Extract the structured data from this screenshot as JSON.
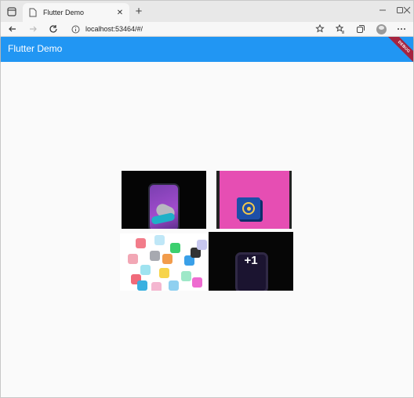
{
  "browser": {
    "tab_title": "Flutter Demo",
    "tab_close": "✕",
    "new_tab": "+",
    "url": "localhost:53464/#/"
  },
  "app": {
    "title": "Flutter Demo",
    "debug_banner": "DEBUG",
    "accent_color": "#2196f3"
  },
  "gallery": {
    "images": [
      {
        "description_icon": "earbuds-phone-photo"
      },
      {
        "description_icon": "target-cube-photo"
      },
      {
        "description_icon": "app-icons-photo"
      },
      {
        "description_icon": "phone-photo"
      }
    ],
    "more_count_label": "+1"
  }
}
